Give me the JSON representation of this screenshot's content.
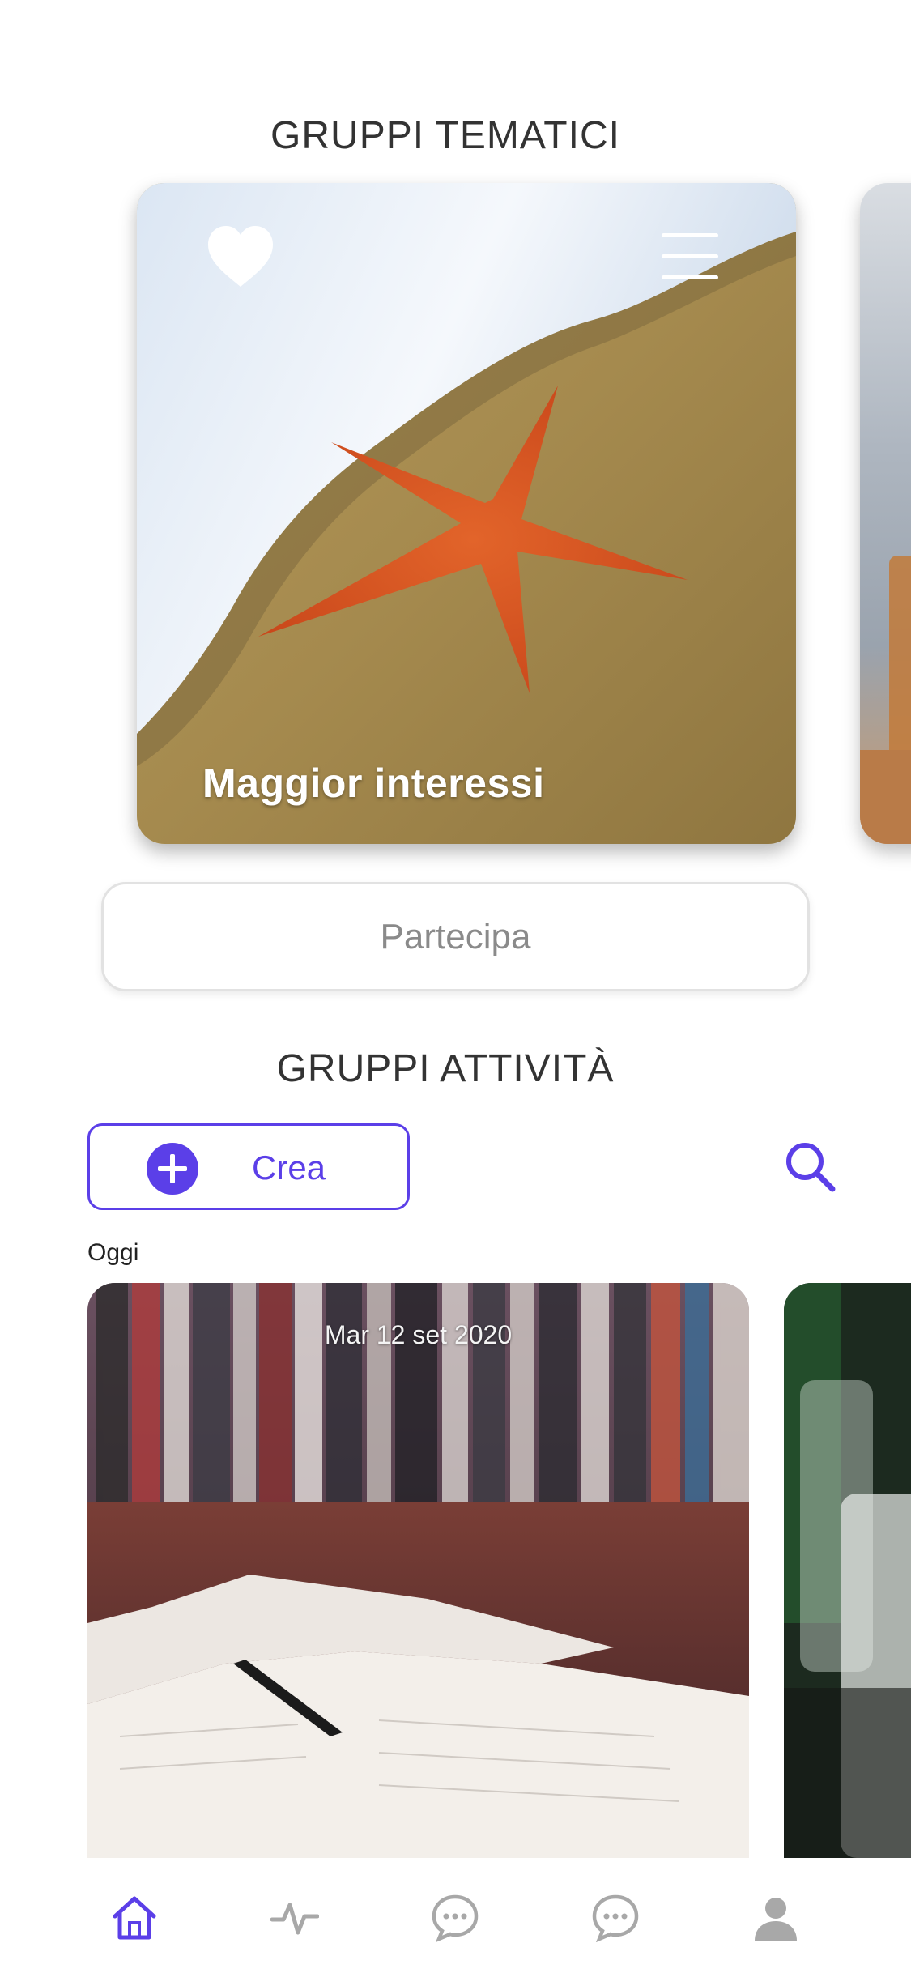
{
  "sections": {
    "thematic_title": "GRUPPI TEMATICI",
    "activity_title": "GRUPPI ATTIVITÀ"
  },
  "thematic_card": {
    "title": "Maggior interessi",
    "favorite_icon": "heart-icon",
    "menu_icon": "menu-icon"
  },
  "join_button": {
    "label": "Partecipa"
  },
  "activity_toolbar": {
    "create_label": "Crea",
    "create_icon": "plus-circle-icon",
    "search_icon": "search-icon"
  },
  "activity_list": {
    "day_label": "Oggi",
    "cards": [
      {
        "date": "Mar 12 set 2020"
      }
    ]
  },
  "tab_bar": {
    "items": [
      {
        "icon": "home-icon",
        "active": true
      },
      {
        "icon": "activity-icon",
        "active": false
      },
      {
        "icon": "chat-icon",
        "active": false
      },
      {
        "icon": "chat-icon",
        "active": false
      },
      {
        "icon": "profile-icon",
        "active": false
      }
    ]
  },
  "colors": {
    "accent": "#5b3fe8",
    "inactive_icon": "#a8a8a8",
    "title_text": "#333333"
  }
}
